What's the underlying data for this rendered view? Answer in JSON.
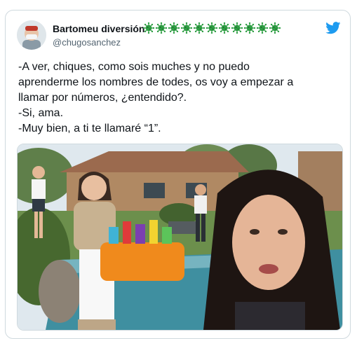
{
  "author": {
    "display_name": "Bartomeu diversión",
    "name_emojis": [
      "virus-icon",
      "virus-icon",
      "virus-icon",
      "virus-icon",
      "virus-icon",
      "virus-icon",
      "virus-icon",
      "virus-icon",
      "virus-icon",
      "virus-icon",
      "virus-icon"
    ],
    "handle": "@chugosanchez"
  },
  "tweet": {
    "lines": [
      "-A ver, chiques, como sois muches y no puedo",
      "aprenderme los nombres de todes, os voy a empezar a",
      "llamar por números, ¿entendido?.",
      "-Si, ama.",
      "-Muy bien, a ti te llamaré “1”."
    ]
  },
  "brand": {
    "icon": "twitter-bird-icon",
    "color": "#1d9bf0"
  },
  "media": {
    "icon": "meme-photo"
  },
  "colors": {
    "text": "#0f1419",
    "secondary": "#536471",
    "border": "#cfd9de",
    "virus": "#2f9e44"
  }
}
